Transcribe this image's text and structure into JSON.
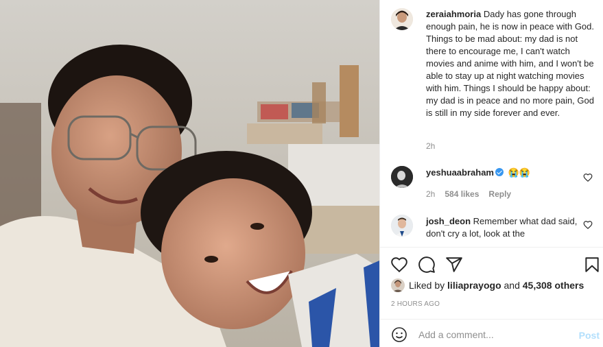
{
  "post": {
    "author": "zeraiahmoria",
    "caption": "Dady has gone through enough pain, he is now in peace with God. Things to be mad about: my dad is not there to encourage me, I can't watch movies and anime with him, and I won't be able to stay up at night watching movies with him. Things I should be happy about: my dad is in peace and no more pain, God is still in my side forever and ever.",
    "caption_time": "2h"
  },
  "comments": [
    {
      "username": "yeshuaabraham",
      "verified": true,
      "text": "😭😭",
      "time": "2h",
      "likes": "584 likes",
      "reply_label": "Reply"
    },
    {
      "username": "josh_deon",
      "text": "Remember what dad said, don't cry a lot, look at the"
    }
  ],
  "likes": {
    "prefix": "Liked by",
    "user": "liliaprayogo",
    "conjunction": "and",
    "others": "45,308 others"
  },
  "timestamp": "2 HOURS AGO",
  "add_comment": {
    "placeholder": "Add a comment...",
    "post_label": "Post"
  },
  "icons": {
    "like": "heart-icon",
    "comment": "comment-icon",
    "share": "paper-plane-icon",
    "save": "bookmark-icon",
    "emoji": "smiley-icon"
  },
  "colors": {
    "text": "#262626",
    "secondary": "#8e8e8e",
    "verified": "#3897f0",
    "post_button_disabled": "#b2dffc"
  }
}
